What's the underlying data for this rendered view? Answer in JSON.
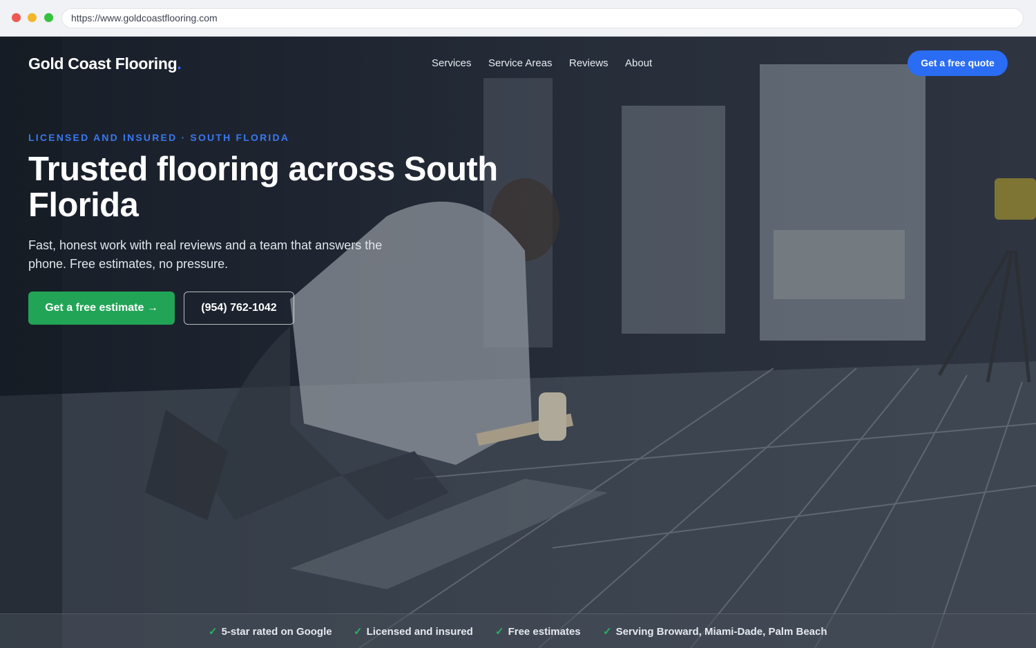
{
  "browser": {
    "url": "https://www.goldcoastflooring.com"
  },
  "header": {
    "brand": "Gold Coast Flooring",
    "brand_dot": ".",
    "nav": [
      "Services",
      "Service Areas",
      "Reviews",
      "About"
    ],
    "quote_button": "Get a free quote"
  },
  "hero": {
    "eyebrow": "LICENSED AND INSURED · SOUTH FLORIDA",
    "headline": "Trusted flooring across South Florida",
    "subtext": "Fast, honest work with real reviews and a team that answers the phone. Free estimates, no pressure.",
    "primary_cta": "Get a free estimate →",
    "phone_cta": "(954) 762-1042"
  },
  "trust_bar": {
    "check_icon": "✓",
    "items": [
      "5-star rated on Google",
      "Licensed and insured",
      "Free estimates",
      "Serving Broward, Miami-Dade, Palm Beach"
    ]
  },
  "colors": {
    "accent_blue": "#2a6cf3",
    "cta_green": "#22a456",
    "check_green": "#27b35e"
  }
}
